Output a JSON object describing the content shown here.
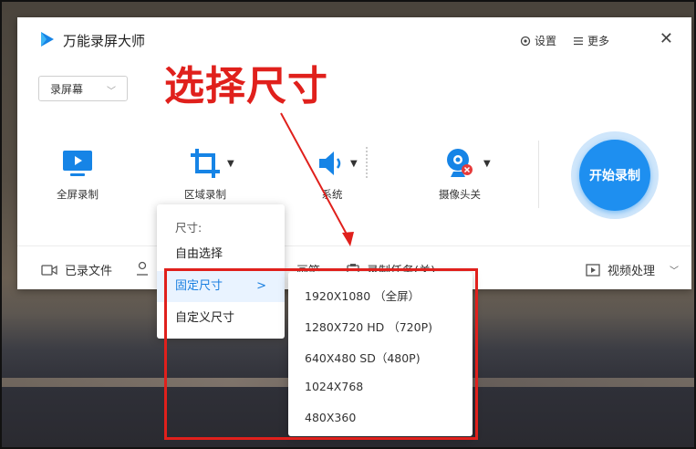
{
  "app": {
    "title": "万能录屏大师",
    "settings_label": "设置",
    "more_label": "更多",
    "close_symbol": "✕",
    "mode_select": "录屏幕"
  },
  "tools": [
    {
      "label": "全屏录制",
      "icon": "monitor-play-icon"
    },
    {
      "label": "区域录制",
      "icon": "crop-icon"
    },
    {
      "label": "系统",
      "icon": "speaker-icon"
    },
    {
      "label": "摄像头关",
      "icon": "webcam-off-icon"
    }
  ],
  "start_button": "开始录制",
  "bottombar": {
    "recorded_files": "已录文件",
    "middle_text": "画笔",
    "task_text": "录制任务(关)",
    "video_processing": "视频处理"
  },
  "size_menu": {
    "header": "尺寸:",
    "items": [
      "自由选择",
      "固定尺寸",
      "自定义尺寸"
    ],
    "selected_index": 1
  },
  "fixed_sizes": [
    "1920X1080 （全屏）",
    "1280X720 HD （720P)",
    "640X480 SD（480P)",
    "1024X768",
    "480X360"
  ],
  "annotation": {
    "text": "选择尺寸"
  },
  "colors": {
    "accent": "#1e8ff0",
    "annotation_red": "#e0201c",
    "icon_blue": "#1684e6"
  }
}
